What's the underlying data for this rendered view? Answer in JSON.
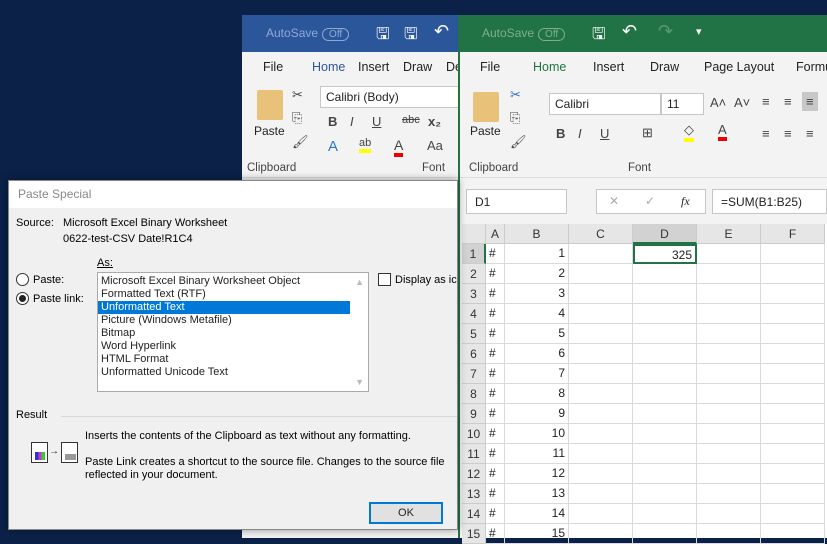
{
  "word": {
    "autosave": "AutoSave",
    "autosave_state": "Off",
    "tabs": [
      "File",
      "Home",
      "Insert",
      "Draw",
      "De"
    ],
    "font_name": "Calibri (Body)",
    "paste_label": "Paste",
    "groups": [
      "Clipboard",
      "Font"
    ],
    "color": "#2b579a"
  },
  "excel": {
    "autosave": "AutoSave",
    "autosave_state": "Off",
    "tabs": [
      "File",
      "Home",
      "Insert",
      "Draw",
      "Page Layout",
      "Formu"
    ],
    "font_name": "Calibri",
    "font_size": "11",
    "paste_label": "Paste",
    "groups": [
      "Clipboard",
      "Font"
    ],
    "name_box": "D1",
    "formula": "=SUM(B1:B25)",
    "fx": "fx",
    "columns": [
      "A",
      "B",
      "C",
      "D",
      "E",
      "F"
    ],
    "rows": [
      {
        "n": "1",
        "a": "#",
        "b": "1",
        "d": "325"
      },
      {
        "n": "2",
        "a": "#",
        "b": "2"
      },
      {
        "n": "3",
        "a": "#",
        "b": "3"
      },
      {
        "n": "4",
        "a": "#",
        "b": "4"
      },
      {
        "n": "5",
        "a": "#",
        "b": "5"
      },
      {
        "n": "6",
        "a": "#",
        "b": "6"
      },
      {
        "n": "7",
        "a": "#",
        "b": "7"
      },
      {
        "n": "8",
        "a": "#",
        "b": "8"
      },
      {
        "n": "9",
        "a": "#",
        "b": "9"
      },
      {
        "n": "10",
        "a": "#",
        "b": "10"
      },
      {
        "n": "11",
        "a": "#",
        "b": "11"
      },
      {
        "n": "12",
        "a": "#",
        "b": "12"
      },
      {
        "n": "13",
        "a": "#",
        "b": "13"
      },
      {
        "n": "14",
        "a": "#",
        "b": "14"
      },
      {
        "n": "15",
        "a": "#",
        "b": "15"
      }
    ],
    "color": "#217346"
  },
  "dialog": {
    "title": "Paste Special",
    "source_label": "Source:",
    "source_line1": "Microsoft Excel Binary Worksheet",
    "source_line2": "0622-test-CSV Date!R1C4",
    "as_label": "As:",
    "paste_label": "Paste:",
    "paste_link_label": "Paste link:",
    "options": [
      "Microsoft Excel Binary Worksheet Object",
      "Formatted Text (RTF)",
      "Unformatted Text",
      "Picture (Windows Metafile)",
      "Bitmap",
      "Word Hyperlink",
      "HTML Format",
      "Unformatted Unicode Text"
    ],
    "selected_index": 2,
    "display_as_icon": "Display as ic",
    "result_label": "Result",
    "result_line1": "Inserts the contents of the Clipboard as text without any formatting.",
    "result_line2": "Paste Link creates a shortcut to the source file. Changes to the source file",
    "result_line3": "reflected in your document.",
    "ok": "OK"
  }
}
